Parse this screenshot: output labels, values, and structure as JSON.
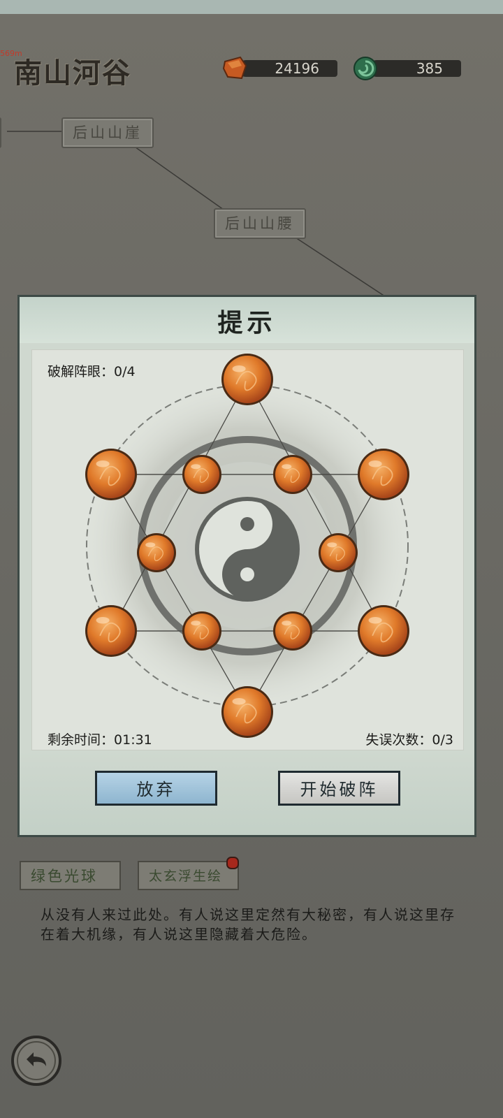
{
  "debug_text": "569m",
  "area_title": "南山河谷",
  "currencies": [
    {
      "icon": "amber-gem-icon",
      "value": "24196"
    },
    {
      "icon": "jade-ring-icon",
      "value": "385"
    }
  ],
  "map": {
    "nodes": [
      "后山山崖",
      "后山山腰"
    ]
  },
  "dialog": {
    "title": "提示",
    "crack_label": "破解阵眼：",
    "crack_value": "0/4",
    "time_label": "剩余时间：",
    "time_value": "01:31",
    "miss_label": "失误次数：",
    "miss_value": "0/3",
    "center_icon": "yin-yang-icon",
    "orb_icon": "dragon-orb-icon",
    "buttons": {
      "quit": "放弃",
      "start": "开始破阵"
    }
  },
  "tags": [
    "绿色光球",
    "太玄浮生绘"
  ],
  "description": "从没有人来过此处。有人说这里定然有大秘密，有人说这里存在着大机缘，有人说这里隐藏着大危险。",
  "colors": {
    "orb": "#e07a2a",
    "orb_rim": "#4a2a14",
    "quit_button": "#9fc3da",
    "ink": "#5f625e"
  }
}
